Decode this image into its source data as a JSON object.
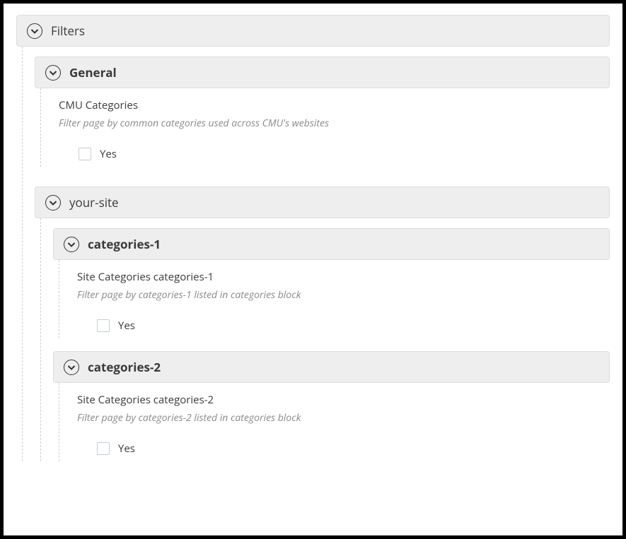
{
  "filters": {
    "title": "Filters",
    "general": {
      "title": "General",
      "field": {
        "label": "CMU Categories",
        "help": "Filter page by common categories used across CMU's websites",
        "option": "Yes"
      }
    },
    "site": {
      "title": "your-site",
      "cat1": {
        "title": "categories-1",
        "field": {
          "label": "Site Categories categories-1",
          "help": "Filter page by categories-1 listed in categories block",
          "option": "Yes"
        }
      },
      "cat2": {
        "title": "categories-2",
        "field": {
          "label": "Site Categories categories-2",
          "help": "Filter page by categories-2 listed in categories block",
          "option": "Yes"
        }
      }
    }
  }
}
